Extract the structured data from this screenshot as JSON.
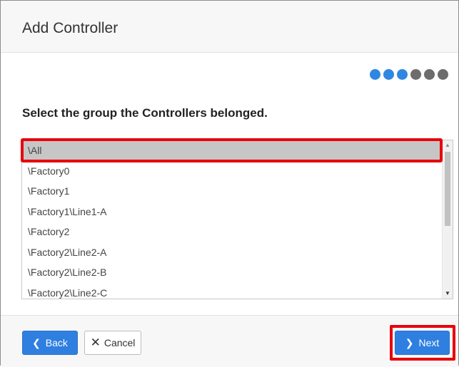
{
  "dialog": {
    "title": "Add Controller",
    "steps": {
      "total": 6,
      "current": 4
    }
  },
  "colors": {
    "accent": "#2f7fe0",
    "step_active": "#2f87e1",
    "step_inactive": "#6d6d6d",
    "highlight": "#e8000b",
    "selection": "#c6c6c6"
  },
  "prompt": "Select the group the Controllers belonged.",
  "group_list": {
    "items": [
      "\\All",
      "\\Factory0",
      "\\Factory1",
      "\\Factory1\\Line1-A",
      "\\Factory2",
      "\\Factory2\\Line2-A",
      "\\Factory2\\Line2-B",
      "\\Factory2\\Line2-C"
    ],
    "selected": "\\All"
  },
  "footer": {
    "back_label": "Back",
    "back_icon": "chevron-left-icon",
    "cancel_label": "Cancel",
    "cancel_icon": "close-icon",
    "next_label": "Next",
    "next_icon": "chevron-right-icon"
  }
}
